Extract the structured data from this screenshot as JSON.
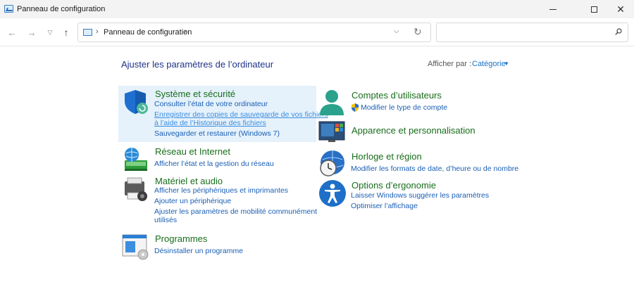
{
  "window": {
    "title": "Panneau de configuration"
  },
  "address": {
    "crumb": "Panneau de configuration",
    "separator": "›",
    "search_placeholder": ""
  },
  "main": {
    "heading": "Ajuster les paramètres de l’ordinateur",
    "view_by_label": "Afficher par :",
    "view_by_value": "Catégorie"
  },
  "categories": {
    "security": {
      "title": "Système et sécurité",
      "links": [
        "Consulter l’état de votre ordinateur",
        "Enregistrer des copies de sauvegarde de vos fichiers",
        "à l’aide de l’Historique des fichiers",
        "Sauvegarder et restaurer (Windows 7)"
      ]
    },
    "network": {
      "title": "Réseau et Internet",
      "links": [
        "Afficher l’état et la gestion du réseau"
      ]
    },
    "hardware": {
      "title": "Matériel et audio",
      "links": [
        "Afficher les périphériques et imprimantes",
        "Ajouter un périphérique",
        "Ajuster les paramètres de mobilité communément",
        "utilisés"
      ]
    },
    "programs": {
      "title": "Programmes",
      "links": [
        "Désinstaller un programme"
      ]
    },
    "accounts": {
      "title": "Comptes d’utilisateurs",
      "links": [
        "Modifier le type de compte"
      ]
    },
    "appearance": {
      "title": "Apparence et personnalisation"
    },
    "clock": {
      "title": "Horloge et région",
      "links": [
        "Modifier les formats de date, d’heure ou de nombre"
      ]
    },
    "ease": {
      "title": "Options d’ergonomie",
      "links": [
        "Laisser Windows suggérer les paramètres",
        "Optimiser l’affichage"
      ]
    }
  },
  "colors": {
    "category_title": "#186d1b",
    "link": "#1a5fb4",
    "heading": "#1e3287",
    "hover_bg": "#e5f1fb"
  }
}
